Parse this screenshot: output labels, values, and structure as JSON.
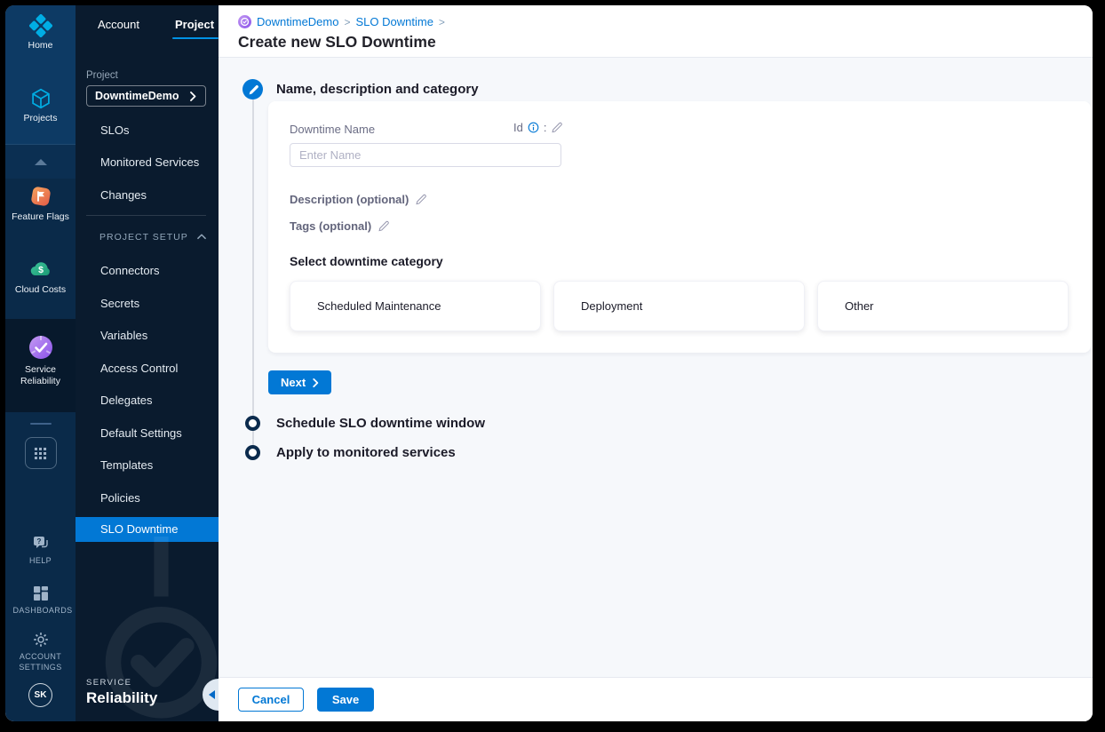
{
  "rail": {
    "home": "Home",
    "projects": "Projects",
    "modules": {
      "feature_flags": "Feature Flags",
      "cloud_costs": "Cloud Costs",
      "service_reliability": "Service Reliability"
    },
    "help": "HELP",
    "dashboards": "DASHBOARDS",
    "account_settings": "ACCOUNT SETTINGS",
    "avatar_initials": "SK"
  },
  "sidenav": {
    "tabs": {
      "account": "Account",
      "project": "Project"
    },
    "project_label": "Project",
    "project_name": "DowntimeDemo",
    "items": [
      "SLOs",
      "Monitored Services",
      "Changes"
    ],
    "setup_header": "PROJECT SETUP",
    "setup_items": [
      "Connectors",
      "Secrets",
      "Variables",
      "Access Control",
      "Delegates",
      "Default Settings",
      "Templates",
      "Policies"
    ],
    "active_item": "SLO Downtime",
    "module_footer": {
      "small": "SERVICE",
      "big": "Reliability"
    }
  },
  "header": {
    "breadcrumb": {
      "project": "DowntimeDemo",
      "section": "SLO Downtime",
      "separator": ">"
    },
    "title": "Create new SLO Downtime"
  },
  "form": {
    "step1_title": "Name, description and category",
    "name_label": "Downtime Name",
    "id_label": "Id",
    "id_colon": ":",
    "name_placeholder": "Enter Name",
    "description_label": "Description (optional)",
    "tags_label": "Tags (optional)",
    "category_label": "Select downtime category",
    "categories": [
      "Scheduled Maintenance",
      "Deployment",
      "Other"
    ],
    "next_label": "Next",
    "step2_title": "Schedule SLO downtime window",
    "step3_title": "Apply to monitored services"
  },
  "footer": {
    "cancel": "Cancel",
    "save": "Save"
  },
  "colors": {
    "accent": "#0278d5",
    "tab_underline": "#0092e4",
    "rail_bg": "#0a2a49",
    "sidenav_bg": "#0a1b2e"
  }
}
